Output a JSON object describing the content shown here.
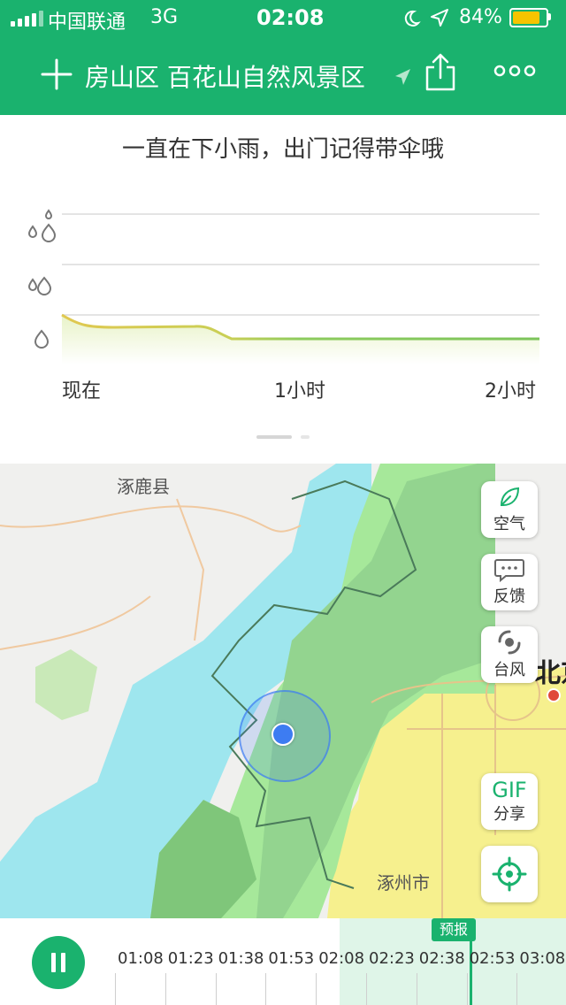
{
  "status_bar": {
    "carrier": "中国联通",
    "network": "3G",
    "time": "02:08",
    "battery": "84%",
    "battery_level": 0.84
  },
  "nav": {
    "location": "房山区 百花山自然风景区"
  },
  "forecast": {
    "headline": "一直在下小雨，出门记得带伞哦",
    "ticks": [
      "现在",
      "1小时",
      "2小时"
    ]
  },
  "map": {
    "labels": {
      "county": "涿鹿县",
      "city": "涿州市",
      "beijing": "北京"
    },
    "buttons": {
      "air": "空气",
      "feedback": "反馈",
      "typhoon": "台风",
      "gif": "GIF",
      "gif_share": "分享"
    }
  },
  "timeline": {
    "forecast_label": "预报",
    "times": [
      "01:08",
      "01:23",
      "01:38",
      "01:53",
      "02:08",
      "02:23",
      "02:38",
      "02:53",
      "03:08"
    ]
  },
  "colors": {
    "brand": "#1ab26e",
    "rain_light": "#9ee6ee",
    "rain_moderate": "#a6e89a",
    "rain_heavy": "#8cc987",
    "dry_yellow": "#f6f08e",
    "location_dot": "#3d7cf2"
  }
}
